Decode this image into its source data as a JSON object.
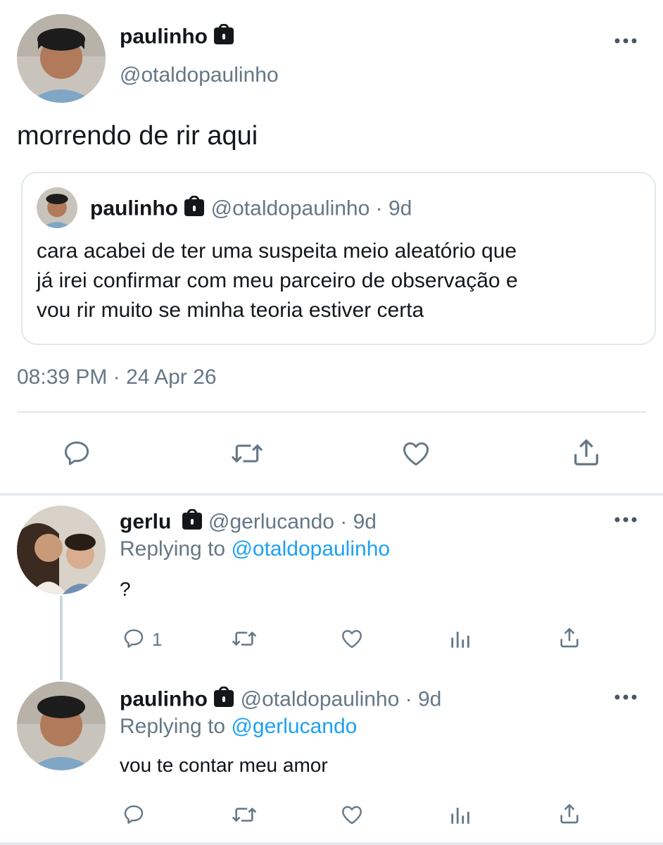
{
  "main_tweet": {
    "display_name": "paulinho",
    "handle": "@otaldopaulinho",
    "text": "morrendo de rir aqui",
    "timestamp": "08:39 PM · 24 Apr 26",
    "quote": {
      "display_name": "paulinho",
      "meta": "@otaldopaulinho · 9d",
      "text_lines": [
        "cara acabei de ter uma suspeita meio aleatório que",
        "já irei confirmar com meu parceiro de observação e",
        "vou rir muito se minha teoria estiver certa"
      ]
    }
  },
  "replies": [
    {
      "display_name": "gerlu",
      "meta": "@gerlucando · 9d",
      "replying_prefix": "Replying to ",
      "replying_handle": "@otaldopaulinho",
      "text": "?",
      "reply_count": "1"
    },
    {
      "display_name": "paulinho",
      "meta": "@otaldopaulinho · 9d",
      "replying_prefix": "Replying to ",
      "replying_handle": "@gerlucando",
      "text": "vou te contar meu amor",
      "reply_count": ""
    }
  ],
  "icons": {
    "lock": "lock-icon",
    "more": "more-icon",
    "reply": "reply-icon",
    "retweet": "retweet-icon",
    "like": "like-icon",
    "analytics": "analytics-icon",
    "share": "share-icon"
  },
  "colors": {
    "accent": "#1da1f2",
    "text": "#14171a",
    "secondary": "#657786",
    "border": "#e1e8ed",
    "icon": "#657786"
  }
}
